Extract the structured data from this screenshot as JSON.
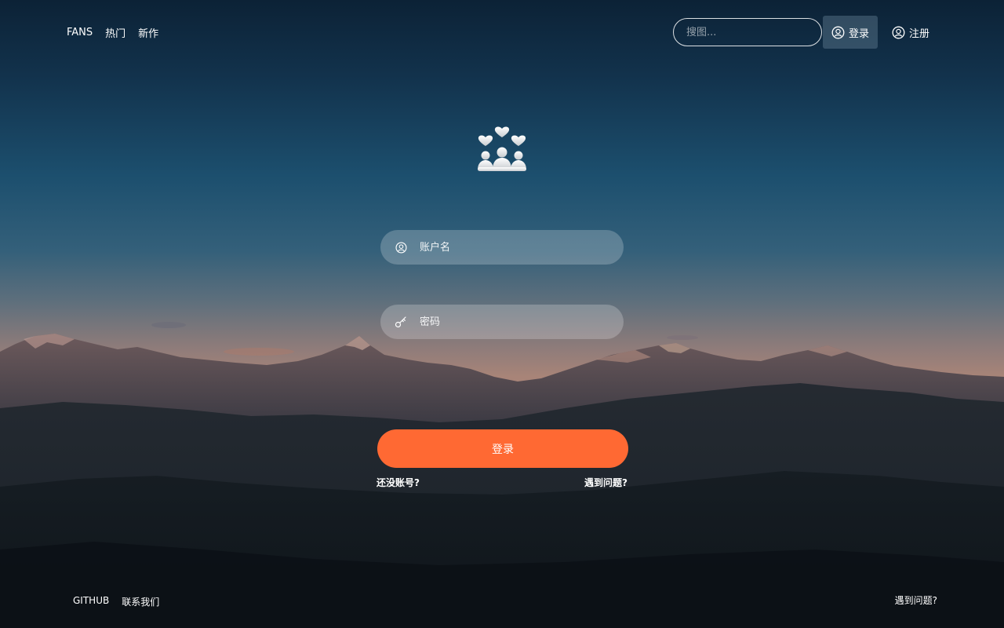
{
  "nav": {
    "items": [
      {
        "label": "FANS"
      },
      {
        "label": "热门"
      },
      {
        "label": "新作"
      }
    ],
    "search_placeholder": "搜图...",
    "login_label": "登录",
    "register_label": "注册"
  },
  "logo": {
    "icon": "fans-hearts-logo-icon"
  },
  "form": {
    "username_placeholder": "账户名",
    "username_icon": "user-icon",
    "password_placeholder": "密码",
    "password_icon": "key-icon",
    "submit_label": "登录",
    "no_account_label": "还没账号?",
    "problem_label": "遇到问题?"
  },
  "footer": {
    "links": [
      {
        "label": "GITHUB"
      },
      {
        "label": "联系我们"
      }
    ],
    "problem_label": "遇到问题?"
  },
  "colors": {
    "accent": "#ff6933",
    "sky_top": "#0e2c44",
    "sky_mid": "#1f5273",
    "horizon": "#a88478"
  }
}
